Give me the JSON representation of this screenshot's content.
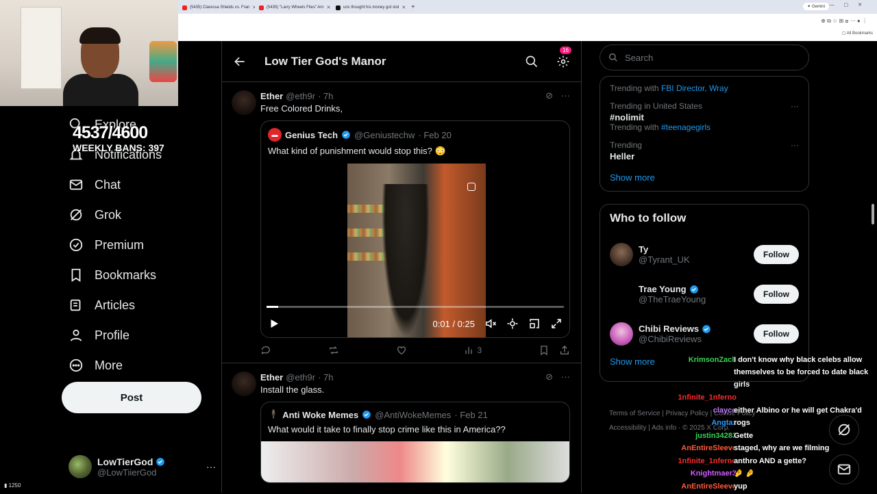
{
  "browser": {
    "tabs": [
      {
        "label": "(5435) Claressa Shields vs. Fran",
        "color": "#e22"
      },
      {
        "label": "(5435) \"Larry Wheels Files\" Arn",
        "color": "#e22"
      },
      {
        "label": "unc thought his money got stol",
        "color": "#111"
      }
    ],
    "gemini_label": "Gemini",
    "bookmarks_label": "All Bookmarks"
  },
  "stream": {
    "score": "4537/4600",
    "weekly": "WEEKLY BANS: 397",
    "viewers": "1250"
  },
  "nav": {
    "items": [
      {
        "label": "Explore",
        "icon": "search-icon"
      },
      {
        "label": "Notifications",
        "icon": "bell-icon"
      },
      {
        "label": "Chat",
        "icon": "mail-icon"
      },
      {
        "label": "Grok",
        "icon": "grok-icon"
      },
      {
        "label": "Premium",
        "icon": "verified-icon"
      },
      {
        "label": "Bookmarks",
        "icon": "bookmark-icon"
      },
      {
        "label": "Articles",
        "icon": "article-icon"
      },
      {
        "label": "Profile",
        "icon": "person-icon"
      },
      {
        "label": "More",
        "icon": "more-circle-icon"
      }
    ],
    "post_label": "Post",
    "account_name": "LowTierGod",
    "account_handle": "@LowTiierGod"
  },
  "main": {
    "title": "Low Tier God's Manor",
    "badge_count": "16",
    "tweets": [
      {
        "name": "Ether",
        "handle": "@eth9r",
        "time": "· 7h",
        "text": "Free Colored Drinks,",
        "quote": {
          "name": "Genius Tech",
          "handle": "@Geniustechw",
          "time": "· Feb 20",
          "text": "What kind of punishment would stop this? 😳",
          "video_time": "0:01 / 0:25",
          "progress": 0.04
        },
        "views": "3"
      },
      {
        "name": "Ether",
        "handle": "@eth9r",
        "time": "· 7h",
        "text": "Install the glass.",
        "quote": {
          "name": "Anti Woke Memes",
          "handle": "@AntiWokeMemes",
          "time": "· Feb 21",
          "text": "What would it take to finally stop crime like this in America??"
        }
      }
    ]
  },
  "right": {
    "search_placeholder": "Search",
    "trends": [
      {
        "ctx": "Trending with",
        "link": "FBI Director, Wray",
        "title": ""
      },
      {
        "ctx": "Trending in United States",
        "title": "#nolimit",
        "with": "Trending with",
        "link": "#teenagegirls"
      },
      {
        "ctx": "Trending",
        "title": "Heller"
      }
    ],
    "show_more": "Show more",
    "who_to_follow": "Who to follow",
    "follow": [
      {
        "name": "Ty",
        "handle": "@Tyrant_UK",
        "verified": false,
        "color": "#6b4a3a"
      },
      {
        "name": "Trae Young",
        "handle": "@TheTraeYoung",
        "verified": true,
        "color": "#000"
      },
      {
        "name": "Chibi Reviews",
        "handle": "@ChibiReviews",
        "verified": true,
        "color": "#c55ab8"
      }
    ],
    "follow_label": "Follow",
    "footer": [
      "Terms of Service",
      "Privacy Policy",
      "Cookie Policy",
      "Accessibility",
      "Ads info",
      "© 2025 X Corp."
    ]
  },
  "chat": [
    {
      "user": "KrimsonZach",
      "color": "#39d353",
      "text": "I don't know why black celebs allow themselves to be forced to date black girls",
      "wrap": true
    },
    {
      "user": "1nfinite_1nferno",
      "color": "#ff2a2a",
      "text": "either Albino or he will get Chakra'd"
    },
    {
      "user": "clayco",
      "color": "#c77dff",
      "text": "either Albino or he will get Chakra'd"
    },
    {
      "user": "Angtaz",
      "color": "#2f9bff",
      "text": "rogs"
    },
    {
      "user": "justin34283",
      "color": "#39d353",
      "text": "Gette"
    },
    {
      "user": "AnEntireSleeve",
      "color": "#ff5a3a",
      "text": "staged, why are we filming"
    },
    {
      "user": "1nfinite_1nferno",
      "color": "#ff2a2a",
      "text": "anthro AND a gette?"
    },
    {
      "user": "Knightmaer3",
      "color": "#d35cff",
      "text": ""
    },
    {
      "user": "AnEntireSleeve",
      "color": "#ff5a3a",
      "text": "yup"
    }
  ]
}
